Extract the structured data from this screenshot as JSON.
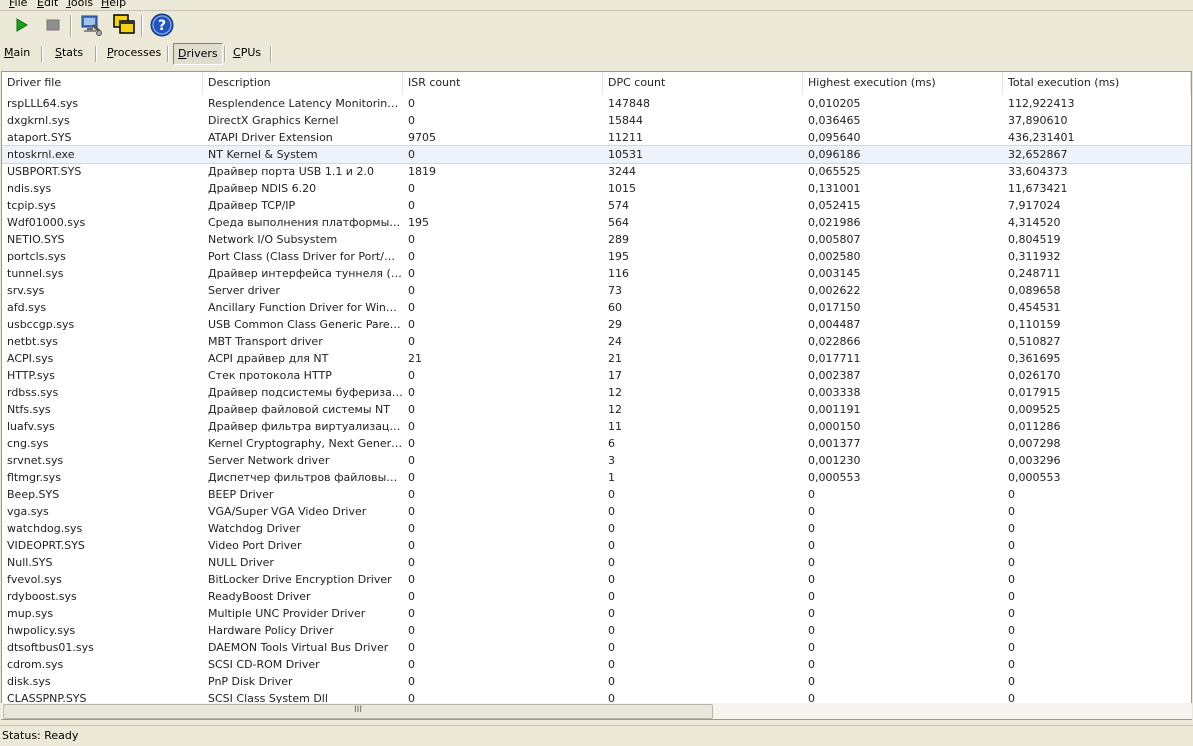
{
  "menu": [
    "File",
    "Edit",
    "Tools",
    "Help"
  ],
  "toolbar": {
    "icons": [
      "play-icon",
      "stop-icon",
      "monitor-settings-icon",
      "windows-icon",
      "help-icon"
    ],
    "colors": {
      "play": "#1aa31a",
      "help": "#2455b8"
    }
  },
  "tabs": [
    {
      "label": "Main"
    },
    {
      "label": "Stats"
    },
    {
      "label": "Processes"
    },
    {
      "label": "Drivers",
      "active": true
    },
    {
      "label": "CPUs"
    }
  ],
  "table": {
    "columns": [
      "Driver file",
      "Description",
      "ISR count",
      "DPC count",
      "Highest execution (ms)",
      "Total execution (ms)"
    ],
    "selected_row": 3,
    "rows": [
      [
        "rspLLL64.sys",
        "Resplendence Latency Monitoring a...",
        "0",
        "147848",
        "0,010205",
        "112,922413"
      ],
      [
        "dxgkrnl.sys",
        "DirectX Graphics Kernel",
        "0",
        "15844",
        "0,036465",
        "37,890610"
      ],
      [
        "ataport.SYS",
        "ATAPI Driver Extension",
        "9705",
        "11211",
        "0,095640",
        "436,231401"
      ],
      [
        "ntoskrnl.exe",
        "NT Kernel & System",
        "0",
        "10531",
        "0,096186",
        "32,652867"
      ],
      [
        "USBPORT.SYS",
        "Драйвер порта USB 1.1 и 2.0",
        "1819",
        "3244",
        "0,065525",
        "33,604373"
      ],
      [
        "ndis.sys",
        "Драйвер NDIS 6.20",
        "0",
        "1015",
        "0,131001",
        "11,673421"
      ],
      [
        "tcpip.sys",
        "Драйвер TCP/IP",
        "0",
        "574",
        "0,052415",
        "7,917024"
      ],
      [
        "Wdf01000.sys",
        "Среда выполнения платформы др...",
        "195",
        "564",
        "0,021986",
        "4,314520"
      ],
      [
        "NETIO.SYS",
        "Network I/O Subsystem",
        "0",
        "289",
        "0,005807",
        "0,804519"
      ],
      [
        "portcls.sys",
        "Port Class (Class Driver for Port/Mini...",
        "0",
        "195",
        "0,002580",
        "0,311932"
      ],
      [
        "tunnel.sys",
        "Драйвер интерфейса туннеля (Ма...",
        "0",
        "116",
        "0,003145",
        "0,248711"
      ],
      [
        "srv.sys",
        "Server driver",
        "0",
        "73",
        "0,002622",
        "0,089658"
      ],
      [
        "afd.sys",
        "Ancillary Function Driver for WinSock",
        "0",
        "60",
        "0,017150",
        "0,454531"
      ],
      [
        "usbccgp.sys",
        "USB Common Class Generic Parent ...",
        "0",
        "29",
        "0,004487",
        "0,110159"
      ],
      [
        "netbt.sys",
        "MBT Transport driver",
        "0",
        "24",
        "0,022866",
        "0,510827"
      ],
      [
        "ACPI.sys",
        "ACPI драйвер для NT",
        "21",
        "21",
        "0,017711",
        "0,361695"
      ],
      [
        "HTTP.sys",
        "Стек протокола HTTP",
        "0",
        "17",
        "0,002387",
        "0,026170"
      ],
      [
        "rdbss.sys",
        "Драйвер подсистемы буферизаци...",
        "0",
        "12",
        "0,003338",
        "0,017915"
      ],
      [
        "Ntfs.sys",
        "Драйвер файловой системы NT",
        "0",
        "12",
        "0,001191",
        "0,009525"
      ],
      [
        "luafv.sys",
        "Драйвер фильтра виртуализации ...",
        "0",
        "11",
        "0,000150",
        "0,011286"
      ],
      [
        "cng.sys",
        "Kernel Cryptography, Next Generation",
        "0",
        "6",
        "0,001377",
        "0,007298"
      ],
      [
        "srvnet.sys",
        "Server Network driver",
        "0",
        "3",
        "0,001230",
        "0,003296"
      ],
      [
        "fltmgr.sys",
        "Диспетчер фильтров файловых с...",
        "0",
        "1",
        "0,000553",
        "0,000553"
      ],
      [
        "Beep.SYS",
        "BEEP Driver",
        "0",
        "0",
        "0",
        "0"
      ],
      [
        "vga.sys",
        "VGA/Super VGA Video Driver",
        "0",
        "0",
        "0",
        "0"
      ],
      [
        "watchdog.sys",
        "Watchdog Driver",
        "0",
        "0",
        "0",
        "0"
      ],
      [
        "VIDEOPRT.SYS",
        "Video Port Driver",
        "0",
        "0",
        "0",
        "0"
      ],
      [
        "Null.SYS",
        "NULL Driver",
        "0",
        "0",
        "0",
        "0"
      ],
      [
        "fvevol.sys",
        "BitLocker Drive Encryption Driver",
        "0",
        "0",
        "0",
        "0"
      ],
      [
        "rdyboost.sys",
        "ReadyBoost Driver",
        "0",
        "0",
        "0",
        "0"
      ],
      [
        "mup.sys",
        "Multiple UNC Provider Driver",
        "0",
        "0",
        "0",
        "0"
      ],
      [
        "hwpolicy.sys",
        "Hardware Policy Driver",
        "0",
        "0",
        "0",
        "0"
      ],
      [
        "dtsoftbus01.sys",
        "DAEMON Tools Virtual Bus Driver",
        "0",
        "0",
        "0",
        "0"
      ],
      [
        "cdrom.sys",
        "SCSI CD-ROM Driver",
        "0",
        "0",
        "0",
        "0"
      ],
      [
        "disk.sys",
        "PnP Disk Driver",
        "0",
        "0",
        "0",
        "0"
      ],
      [
        "CLASSPNP.SYS",
        "SCSI Class System Dll",
        "0",
        "0",
        "0",
        "0"
      ]
    ]
  },
  "scrollbar": {
    "grip": "III"
  },
  "status": "Status: Ready"
}
